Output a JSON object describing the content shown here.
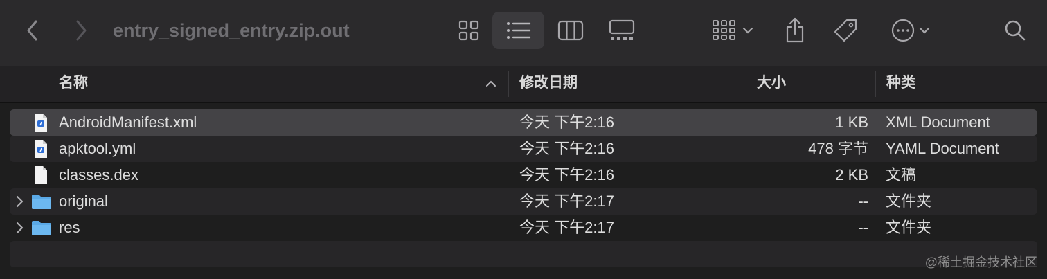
{
  "window": {
    "title": "entry_signed_entry.zip.out"
  },
  "toolbar": {
    "back_icon": "chevron-left-icon",
    "forward_icon": "chevron-right-icon",
    "view_icons": [
      "grid-view-icon",
      "list-view-icon",
      "columns-view-icon",
      "gallery-view-icon"
    ],
    "active_view": "list-view-icon",
    "group_icon": "group-by-icon",
    "share_icon": "share-icon",
    "tag_icon": "tag-icon",
    "more_icon": "more-actions-icon",
    "search_icon": "search-icon"
  },
  "columns": {
    "name": "名称",
    "date": "修改日期",
    "size": "大小",
    "kind": "种类"
  },
  "files": [
    {
      "name": "AndroidManifest.xml",
      "date": "今天 下午2:16",
      "size": "1 KB",
      "kind": "XML Document",
      "icon": "xml-document-icon",
      "folder": false
    },
    {
      "name": "apktool.yml",
      "date": "今天 下午2:16",
      "size": "478 字节",
      "kind": "YAML Document",
      "icon": "yaml-document-icon",
      "folder": false
    },
    {
      "name": "classes.dex",
      "date": "今天 下午2:16",
      "size": "2 KB",
      "kind": "文稿",
      "icon": "document-icon",
      "folder": false
    },
    {
      "name": "original",
      "date": "今天 下午2:17",
      "size": "--",
      "kind": "文件夹",
      "icon": "folder-icon",
      "folder": true
    },
    {
      "name": "res",
      "date": "今天 下午2:17",
      "size": "--",
      "kind": "文件夹",
      "icon": "folder-icon",
      "folder": true
    }
  ],
  "watermark": "@稀土掘金技术社区",
  "colors": {
    "accent_folder": "#5aa9e6",
    "selection": "#444346",
    "window_bg": "#1e1e1e"
  }
}
